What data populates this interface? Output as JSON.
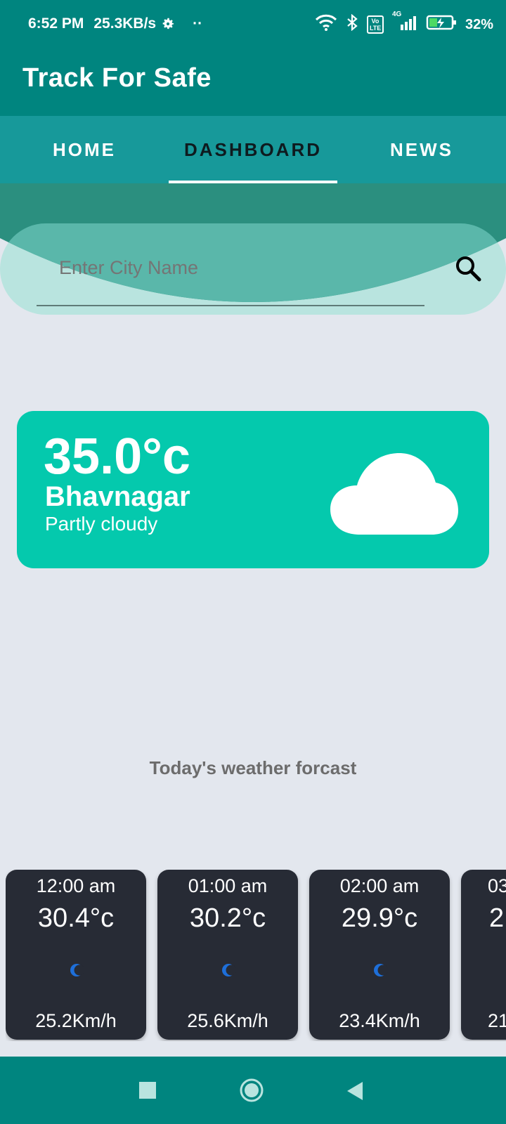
{
  "status_bar": {
    "time": "6:52 PM",
    "net_speed": "25.3KB/s",
    "dots": "··",
    "network": "4G",
    "battery": "32%",
    "volte": "Vo LTE"
  },
  "app": {
    "title": "Track For Safe"
  },
  "tabs": [
    {
      "label": "HOME",
      "active": false
    },
    {
      "label": "DASHBOARD",
      "active": true
    },
    {
      "label": "NEWS",
      "active": false
    }
  ],
  "search": {
    "placeholder": "Enter City Name",
    "value": ""
  },
  "current_weather": {
    "temperature": "35.0°c",
    "city": "Bhavnagar",
    "condition": "Partly cloudy",
    "icon": "cloud-icon"
  },
  "forecast": {
    "title": "Today's weather forcast",
    "hours": [
      {
        "time": "12:00 am",
        "temp": "30.4°c",
        "icon": "moon-icon",
        "wind": "25.2Km/h"
      },
      {
        "time": "01:00 am",
        "temp": "30.2°c",
        "icon": "moon-icon",
        "wind": "25.6Km/h"
      },
      {
        "time": "02:00 am",
        "temp": "29.9°c",
        "icon": "moon-icon",
        "wind": "23.4Km/h"
      },
      {
        "time": "03",
        "temp": "2",
        "icon": "moon-icon",
        "wind": "21"
      }
    ]
  },
  "colors": {
    "appbar": "#00857f",
    "tabs": "#17999a",
    "card": "#04c9ad",
    "hour_card": "#272b35",
    "background": "#e3e7ee"
  },
  "nav": {
    "recent": "square-icon",
    "home": "circle-icon",
    "back": "triangle-back-icon"
  }
}
